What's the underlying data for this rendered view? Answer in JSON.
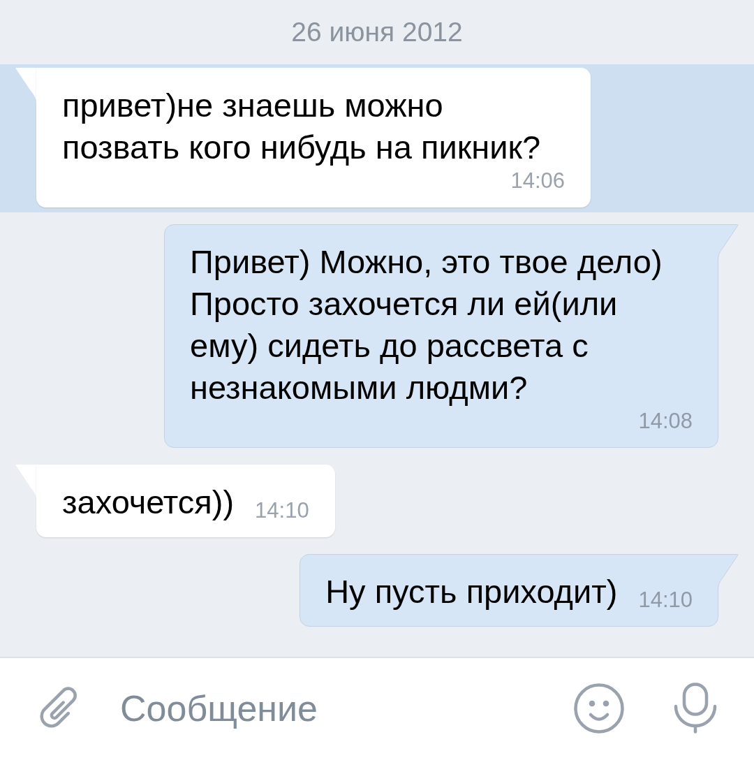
{
  "date_header": {
    "text": "26 июня 2012"
  },
  "messages": [
    {
      "kind": "incoming",
      "unread": true,
      "text": "привет)не знаешь можно позвать кого нибудь на пикник?",
      "time": "14:06"
    },
    {
      "kind": "outgoing",
      "unread": false,
      "text": "Привет) Можно, это твое дело) Просто захочется ли ей(или ему) сидеть до рассвета с незнакомыми людми?",
      "time": "14:08"
    },
    {
      "kind": "incoming",
      "unread": false,
      "text": "захочется))",
      "time": "14:10"
    },
    {
      "kind": "outgoing",
      "unread": false,
      "text": "Ну пусть приходит)",
      "time": "14:10"
    }
  ],
  "composer": {
    "placeholder": "Сообщение"
  }
}
